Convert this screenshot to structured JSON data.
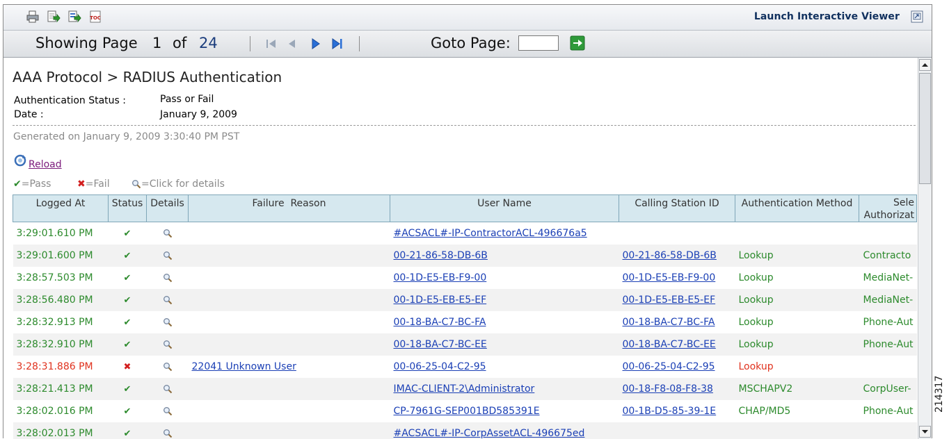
{
  "toolbar": {
    "icons": [
      "print-icon",
      "export-icon",
      "export-data-icon",
      "toc-icon"
    ],
    "launch_label": "Launch Interactive Viewer"
  },
  "pager": {
    "showing_label": "Showing Page",
    "current_page": "1",
    "of_label": "of",
    "total_pages": "24",
    "goto_label": "Goto Page:",
    "goto_value": ""
  },
  "report": {
    "title": "AAA Protocol > RADIUS Authentication",
    "params": [
      {
        "label": "Authentication Status :",
        "value": "Pass or Fail"
      },
      {
        "label": "Date :",
        "value": "January 9, 2009"
      }
    ],
    "generated": "Generated on January 9, 2009 3:30:40 PM PST",
    "reload_label": "Reload",
    "legend": {
      "pass": "=Pass",
      "fail": "=Fail",
      "details": "=Click for details"
    }
  },
  "table": {
    "columns": [
      "Logged At",
      "Status",
      "Details",
      "Failure  Reason",
      "User Name",
      "Calling Station ID",
      "Authentication Method",
      "Sele\nAuthorizat"
    ],
    "rows": [
      {
        "logged_at": "3:29:01.610 PM",
        "status": "pass",
        "failure_reason": "",
        "user_name": "#ACSACL#-IP-ContractorACL-496676a5",
        "calling_station_id": "",
        "auth_method": "",
        "authz": ""
      },
      {
        "logged_at": "3:29:01.600 PM",
        "status": "pass",
        "failure_reason": "",
        "user_name": "00-21-86-58-DB-6B",
        "calling_station_id": "00-21-86-58-DB-6B",
        "auth_method": "Lookup",
        "authz": "Contracto"
      },
      {
        "logged_at": "3:28:57.503 PM",
        "status": "pass",
        "failure_reason": "",
        "user_name": "00-1D-E5-EB-F9-00",
        "calling_station_id": "00-1D-E5-EB-F9-00",
        "auth_method": "Lookup",
        "authz": "MediaNet-"
      },
      {
        "logged_at": "3:28:56.480 PM",
        "status": "pass",
        "failure_reason": "",
        "user_name": "00-1D-E5-EB-E5-EF",
        "calling_station_id": "00-1D-E5-EB-E5-EF",
        "auth_method": "Lookup",
        "authz": "MediaNet-"
      },
      {
        "logged_at": "3:28:32.913 PM",
        "status": "pass",
        "failure_reason": "",
        "user_name": "00-18-BA-C7-BC-FA",
        "calling_station_id": "00-18-BA-C7-BC-FA",
        "auth_method": "Lookup",
        "authz": "Phone-Aut"
      },
      {
        "logged_at": "3:28:32.910 PM",
        "status": "pass",
        "failure_reason": "",
        "user_name": "00-18-BA-C7-BC-EE",
        "calling_station_id": "00-18-BA-C7-BC-EE",
        "auth_method": "Lookup",
        "authz": "Phone-Aut"
      },
      {
        "logged_at": "3:28:31.886 PM",
        "status": "fail",
        "failure_reason": "22041 Unknown User",
        "user_name": "00-06-25-04-C2-95",
        "calling_station_id": "00-06-25-04-C2-95",
        "auth_method": "Lookup",
        "authz": ""
      },
      {
        "logged_at": "3:28:21.413 PM",
        "status": "pass",
        "failure_reason": "",
        "user_name": "IMAC-CLIENT-2\\Administrator",
        "calling_station_id": "00-18-F8-08-F8-38",
        "auth_method": "MSCHAPV2",
        "authz": "CorpUser-"
      },
      {
        "logged_at": "3:28:02.016 PM",
        "status": "pass",
        "failure_reason": "",
        "user_name": "CP-7961G-SEP001BD585391E",
        "calling_station_id": "00-1B-D5-85-39-1E",
        "auth_method": "CHAP/MD5",
        "authz": "Phone-Aut"
      },
      {
        "logged_at": "3:28:02.013 PM",
        "status": "pass",
        "failure_reason": "",
        "user_name": "#ACSACL#-IP-CorpAssetACL-496675ed",
        "calling_station_id": "",
        "auth_method": "",
        "authz": ""
      }
    ]
  },
  "side_code": "214317",
  "colors": {
    "pass": "#2c8a2c",
    "fail": "#e0321e",
    "link": "#1a3fb5",
    "header_bg": "#d6e8ef"
  }
}
